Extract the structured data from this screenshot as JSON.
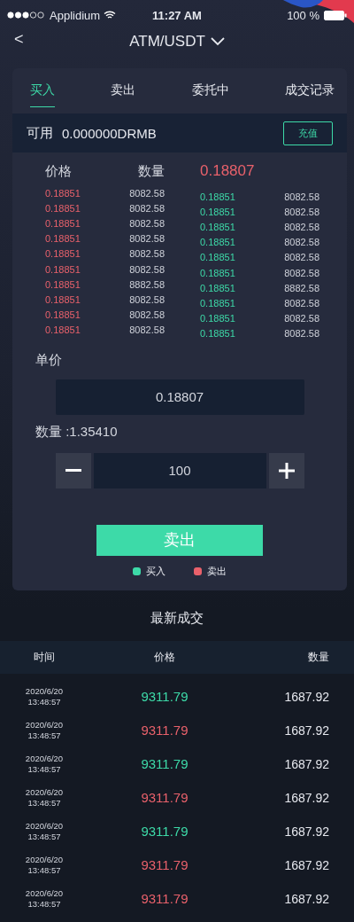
{
  "status_bar": {
    "carrier": "Applidium",
    "time": "11:27 AM",
    "battery": "100 %"
  },
  "nav": {
    "back": "<",
    "title": "ATM/USDT"
  },
  "tabs": [
    {
      "label": "买入",
      "selected": true
    },
    {
      "label": "卖出",
      "selected": false
    },
    {
      "label": "委托中",
      "selected": false
    },
    {
      "label": "成交记录",
      "selected": false
    }
  ],
  "balance": {
    "label": "可用",
    "value": "0.000000DRMB",
    "button": "充值"
  },
  "order_book": {
    "price_header": "价格",
    "amount_header": "数量",
    "last_price": "0.18807",
    "asks": [
      {
        "price": "0.18851",
        "amount": "8082.58"
      },
      {
        "price": "0.18851",
        "amount": "8082.58"
      },
      {
        "price": "0.18851",
        "amount": "8082.58"
      },
      {
        "price": "0.18851",
        "amount": "8082.58"
      },
      {
        "price": "0.18851",
        "amount": "8082.58"
      },
      {
        "price": "0.18851",
        "amount": "8082.58"
      },
      {
        "price": "0.18851",
        "amount": "8882.58"
      },
      {
        "price": "0.18851",
        "amount": "8082.58"
      },
      {
        "price": "0.18851",
        "amount": "8082.58"
      },
      {
        "price": "0.18851",
        "amount": "8082.58"
      }
    ],
    "bids": [
      {
        "price": "0.18851",
        "amount": "8082.58"
      },
      {
        "price": "0.18851",
        "amount": "8082.58"
      },
      {
        "price": "0.18851",
        "amount": "8082.58"
      },
      {
        "price": "0.18851",
        "amount": "8082.58"
      },
      {
        "price": "0.18851",
        "amount": "8082.58"
      },
      {
        "price": "0.18851",
        "amount": "8082.58"
      },
      {
        "price": "0.18851",
        "amount": "8882.58"
      },
      {
        "price": "0.18851",
        "amount": "8082.58"
      },
      {
        "price": "0.18851",
        "amount": "8082.58"
      },
      {
        "price": "0.18851",
        "amount": "8082.58"
      }
    ]
  },
  "form": {
    "price_label": "单价",
    "price_value": "0.18807",
    "amount_label": "数量 :1.35410",
    "quantity": "100",
    "submit": "卖出"
  },
  "legend": [
    {
      "label": "买入",
      "color": "#3ddaa8"
    },
    {
      "label": "卖出",
      "color": "#e9616b"
    }
  ],
  "trades": {
    "title": "最新成交",
    "columns": [
      "时间",
      "价格",
      "数量"
    ],
    "rows": [
      {
        "date": "2020/6/20",
        "time": "13:48:57",
        "price": "9311.79",
        "amount": "1687.92",
        "kind": "buy"
      },
      {
        "date": "2020/6/20",
        "time": "13:48:57",
        "price": "9311.79",
        "amount": "1687.92",
        "kind": "sell"
      },
      {
        "date": "2020/6/20",
        "time": "13:48:57",
        "price": "9311.79",
        "amount": "1687.92",
        "kind": "buy"
      },
      {
        "date": "2020/6/20",
        "time": "13:48:57",
        "price": "9311.79",
        "amount": "1687.92",
        "kind": "sell"
      },
      {
        "date": "2020/6/20",
        "time": "13:48:57",
        "price": "9311.79",
        "amount": "1687.92",
        "kind": "buy"
      },
      {
        "date": "2020/6/20",
        "time": "13:48:57",
        "price": "9311.79",
        "amount": "1687.92",
        "kind": "sell"
      },
      {
        "date": "2020/6/20",
        "time": "13:48:57",
        "price": "9311.79",
        "amount": "1687.92",
        "kind": "sell"
      }
    ]
  }
}
